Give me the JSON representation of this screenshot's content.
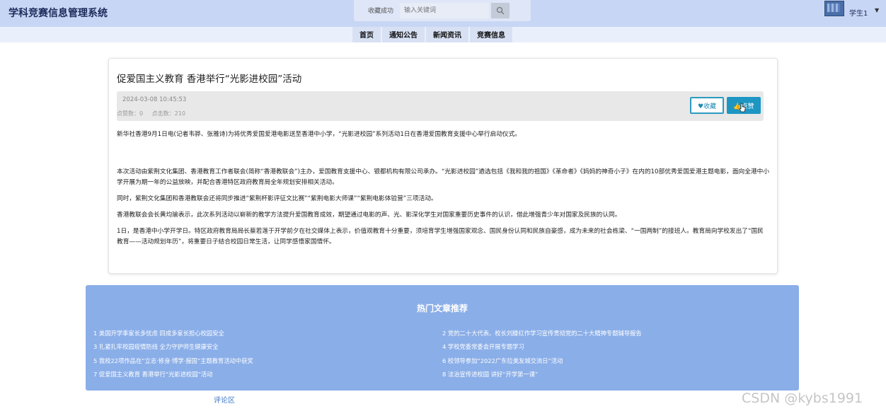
{
  "header": {
    "brand": "学科竞赛信息管理系统",
    "toast": "收藏成功",
    "search": {
      "placeholder": "输入关键词"
    },
    "user": {
      "name": "学生1",
      "caret": "▼"
    }
  },
  "nav": {
    "items": [
      {
        "label": "首页"
      },
      {
        "label": "通知公告"
      },
      {
        "label": "新闻资讯"
      },
      {
        "label": "竞赛信息"
      }
    ]
  },
  "article": {
    "title": "促爱国主义教育 香港举行“光影进校园”活动",
    "date": "2024-03-08 10:45:53",
    "likes": "点赞数：0",
    "views": "点击数：210",
    "fav_label": "♥收藏",
    "like_label": "👍点赞",
    "paragraphs": [
      "新华社香港9月1日电(记者韦骅、张雅诗)为将优秀爱国爱港电影送至香港中小学，“光影进校园”系列活动1日在香港爱国教育支援中心举行启动仪式。",
      "本次活动由紫荆文化集团、香港教育工作者联会(简称“香港教联会”)主办，爱国教育支援中心、银都机构有限公司承办。“光影进校园”遴选包括《我和我的祖国》《革命者》《妈妈的神奇小子》在内的10部优秀爱国爱港主题电影，面向全港中小学开展为期一年的公益放映，并配合香港特区政府教育局全年规划安排相关活动。",
      "同时，紫荆文化集团和香港教联会还将同步推进“紫荆杯影评征文比赛”“紫荆电影大师课”“紫荆电影体验营”三项活动。",
      "香港教联会会长黄均瑜表示，此次系列活动以崭新的教学方法提升爱国教育成效，期望通过电影的声、光、影深化学生对国家重要历史事件的认识，借此增强青少年对国家及民族的认同。",
      "1日，是香港中小学开学日。特区政府教育局局长蔡若莲于开学前夕在社交媒体上表示，价值观教育十分重要，须培育学生增强国家观念、国民身份认同和民族自豪感，成为未来的社会栋梁、“一国两制”的接班人。教育局向学校发出了“国民教育——活动规划年历”，将重要日子结合校园日常生活，让同学感悟家国情怀。"
    ]
  },
  "hot": {
    "title": "热门文章推荐",
    "left": [
      "1  美国开学季家长多忧虑 四成多家长担心校园安全",
      "3  扎紧扎牢校园疫情防线 全力守护师生健康安全",
      "5  我校22项作品在“立志·修身·博学·报国”主题教育活动中获奖",
      "7  促爱国主义教育 香港举行“光影进校园”活动"
    ],
    "right": [
      "2  党的二十大代表、校长刘滕红作学习宣传贯彻党的二十大精神专题辅导报告",
      "4  学校党委常委会开展专题学习",
      "6  校领导参加“2022广东拉美友城交流日”活动",
      "8  法治宣传进校园 讲好“开学第一课”"
    ]
  },
  "comment_link": "评论区",
  "watermark": "CSDN @kybs1991"
}
